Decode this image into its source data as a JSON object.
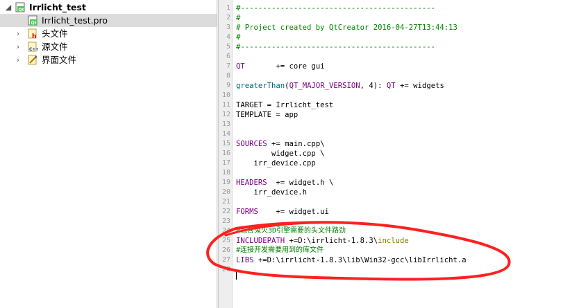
{
  "project_tree": {
    "root": {
      "label": "Irrlicht_test",
      "icon": "qt-project-icon"
    },
    "items": [
      {
        "label": "Irrlicht_test.pro",
        "icon": "pro-file-icon",
        "selected": true
      },
      {
        "label": "头文件",
        "icon": "header-folder-icon"
      },
      {
        "label": "源文件",
        "icon": "source-folder-icon"
      },
      {
        "label": "界面文件",
        "icon": "forms-folder-icon"
      }
    ]
  },
  "editor": {
    "line_numbers": [
      "1",
      "2",
      "3",
      "4",
      "5",
      "6",
      "7",
      "8",
      "9",
      "10",
      "11",
      "12",
      "13",
      "14",
      "15",
      "16",
      "17",
      "18",
      "19",
      "20",
      "21",
      "22",
      "23",
      "24",
      "25",
      "26",
      "27",
      "28"
    ],
    "lines": {
      "l1": "#--------------------------------------------",
      "l2": "#",
      "l3": "# Project created by QtCreator 2016-04-27T13:44:13",
      "l4": "#",
      "l5": "#--------------------------------------------",
      "l7a": "QT",
      "l7b": "       += core gui",
      "l9a": "greaterThan",
      "l9b": "(",
      "l9c": "QT_MAJOR_VERSION",
      "l9d": ", 4): ",
      "l9e": "QT",
      "l9f": " += widgets",
      "l11": "TARGET = Irrlicht_test",
      "l12": "TEMPLATE = app",
      "l15a": "SOURCES",
      "l15b": " += main.cpp\\",
      "l16": "        widget.cpp \\",
      "l17": "    irr_device.cpp",
      "l19a": "HEADERS",
      "l19b": "  += widget.h \\",
      "l20": "    irr_device.h",
      "l22a": "FORMS",
      "l22b": "    += widget.ui",
      "l24": "#包含鬼火3D引擎需要的头文件路劲",
      "l25a": "INCLUDEPATH",
      "l25b": " +=D:\\irrlicht-1.8.3\\",
      "l25c": "include",
      "l26": "#连接开发需要用到的库文件",
      "l27a": "LIBS",
      "l27b": " +=D:\\irrlicht-1.8.3\\lib\\Win32-gcc\\libIrrlicht.a"
    }
  },
  "colors": {
    "comment": "#008000",
    "keyword": "#800080",
    "function": "#00677c",
    "include": "#808000",
    "annotation": "#ff2020"
  }
}
